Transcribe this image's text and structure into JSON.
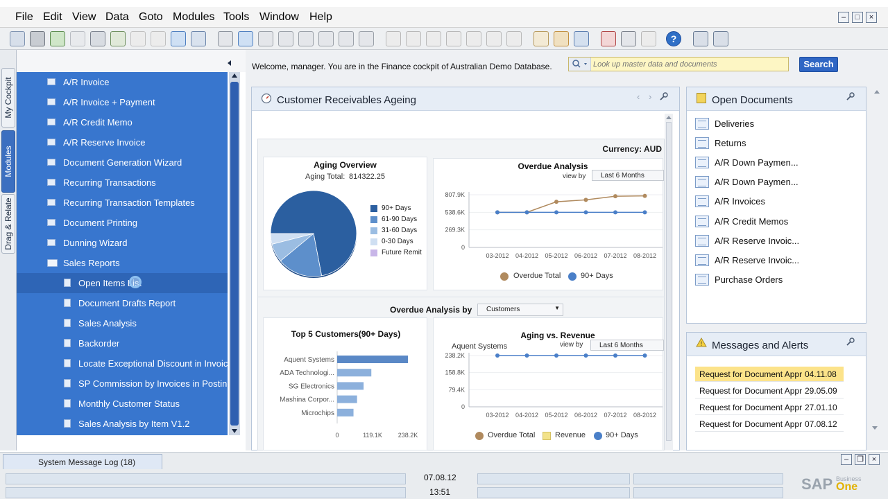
{
  "menu": [
    "File",
    "Edit",
    "View",
    "Data",
    "Goto",
    "Modules",
    "Tools",
    "Window",
    "Help"
  ],
  "vertical_tabs": [
    "My Cockpit",
    "Modules",
    "Drag & Relate"
  ],
  "modules": [
    {
      "label": "A/R Invoice",
      "icon": "form-icon"
    },
    {
      "label": "A/R Invoice + Payment",
      "icon": "form-icon"
    },
    {
      "label": "A/R Credit Memo",
      "icon": "form-icon"
    },
    {
      "label": "A/R Reserve Invoice",
      "icon": "form-icon"
    },
    {
      "label": "Document Generation Wizard",
      "icon": "form-icon"
    },
    {
      "label": "Recurring Transactions",
      "icon": "form-icon"
    },
    {
      "label": "Recurring Transaction Templates",
      "icon": "form-icon"
    },
    {
      "label": "Document Printing",
      "icon": "form-icon"
    },
    {
      "label": "Dunning Wizard",
      "icon": "form-icon"
    },
    {
      "label": "Sales Reports",
      "icon": "folder-open-icon"
    },
    {
      "label": "Open Items List",
      "icon": "report-icon"
    },
    {
      "label": "Document Drafts Report",
      "icon": "report-icon"
    },
    {
      "label": "Sales Analysis",
      "icon": "report-icon"
    },
    {
      "label": "Backorder",
      "icon": "report-icon"
    },
    {
      "label": "Locate Exceptional Discount in Invoice",
      "icon": "query-icon"
    },
    {
      "label": "SP Commission by Invoices in Posting",
      "icon": "query-icon"
    },
    {
      "label": "Monthly Customer Status",
      "icon": "layout-icon"
    },
    {
      "label": "Sales Analysis by Item V1.2",
      "icon": "layout-icon"
    }
  ],
  "welcome": "Welcome, manager. You are in the Finance cockpit of Australian Demo Database.",
  "search": {
    "placeholder": "Look up master data and documents",
    "button": "Search"
  },
  "receivables": {
    "title": "Customer Receivables Ageing",
    "currency": "Currency: AUD",
    "overdue_by_label": "Overdue Analysis by",
    "overdue_by_value": "Customers"
  },
  "aging_overview": {
    "title": "Aging Overview",
    "total_label": "Aging Total:",
    "total_value": "814322.25",
    "legend": [
      {
        "name": "90+ Days",
        "color": "#2b5fa0"
      },
      {
        "name": "61-90 Days",
        "color": "#5d8fcb"
      },
      {
        "name": "31-60 Days",
        "color": "#9bbde2"
      },
      {
        "name": "0-30 Days",
        "color": "#cfdff2"
      },
      {
        "name": "Future Remit",
        "color": "#c8b6e8"
      }
    ]
  },
  "overdue_analysis": {
    "title": "Overdue Analysis",
    "view_by": "view by",
    "period": "Last 6 Months",
    "legend": [
      "Overdue Total",
      "90+ Days"
    ]
  },
  "top5": {
    "title": "Top 5 Customers(90+ Days)"
  },
  "aging_revenue": {
    "title": "Aging vs. Revenue",
    "customer": "Aquent Systems",
    "view_by": "view by",
    "period": "Last 6 Months",
    "legend": [
      "Overdue Total",
      "Revenue",
      "90+ Days"
    ]
  },
  "chart_data": [
    {
      "type": "pie",
      "title": "Aging Overview",
      "labels": [
        "90+ Days",
        "61-90 Days",
        "31-60 Days",
        "0-30 Days",
        "Future Remit"
      ],
      "values": [
        72,
        17,
        7,
        4,
        0
      ]
    },
    {
      "type": "line",
      "title": "Overdue Analysis",
      "categories": [
        "03-2012",
        "04-2012",
        "05-2012",
        "06-2012",
        "07-2012",
        "08-2012"
      ],
      "yticks": [
        "0",
        "269.3K",
        "538.6K",
        "807.9K"
      ],
      "ylim": [
        0,
        807.9
      ],
      "series": [
        {
          "name": "Overdue Total",
          "color": "#b08a5e",
          "values": [
            538.6,
            538.6,
            700,
            730,
            785,
            790
          ]
        },
        {
          "name": "90+ Days",
          "color": "#4a7fc8",
          "values": [
            538.6,
            538.6,
            538.6,
            538.6,
            538.6,
            538.6
          ]
        }
      ]
    },
    {
      "type": "bar",
      "title": "Top 5 Customers(90+ Days)",
      "categories": [
        "Aquent Systems",
        "ADA Technologi...",
        "SG Electronics",
        "Mashina Corpor...",
        "Microchips"
      ],
      "values": [
        238.2,
        115,
        89,
        67,
        55
      ],
      "xticks": [
        "0",
        "119.1K",
        "238.2K"
      ],
      "xlim": [
        0,
        238.2
      ]
    },
    {
      "type": "line",
      "title": "Aging vs. Revenue",
      "categories": [
        "03-2012",
        "04-2012",
        "05-2012",
        "06-2012",
        "07-2012",
        "08-2012"
      ],
      "yticks": [
        "0",
        "79.4K",
        "158.8K",
        "238.2K"
      ],
      "ylim": [
        0,
        238.2
      ],
      "series": [
        {
          "name": "Overdue Total",
          "color": "#b08a5e",
          "values": [
            238.2,
            238.2,
            238.2,
            238.2,
            238.2,
            238.2
          ]
        },
        {
          "name": "Revenue",
          "color": "#f2e28a",
          "values": [
            238.2,
            238.2,
            238.2,
            238.2,
            238.2,
            238.2
          ]
        },
        {
          "name": "90+ Days",
          "color": "#4a7fc8",
          "values": [
            238.2,
            238.2,
            238.2,
            238.2,
            238.2,
            238.2
          ]
        }
      ]
    }
  ],
  "open_documents": {
    "title": "Open Documents",
    "items": [
      "Deliveries",
      "Returns",
      "A/R Down Paymen...",
      "A/R Down Paymen...",
      "A/R Invoices",
      "A/R Credit Memos",
      "A/R Reserve Invoic...",
      "A/R Reserve Invoic...",
      "Purchase Orders"
    ]
  },
  "messages": {
    "title": "Messages and Alerts",
    "items": [
      {
        "text": "Request for Document Approval",
        "date": "04.11.08"
      },
      {
        "text": "Request for Document Approval",
        "date": "29.05.09"
      },
      {
        "text": "Request for Document Approval",
        "date": "27.01.10"
      },
      {
        "text": "Request for Document Approval",
        "date": "07.08.12"
      }
    ]
  },
  "status": {
    "system_log": "System Message Log (18)",
    "date": "07.08.12",
    "time": "13:51"
  },
  "logo": {
    "brand": "SAP",
    "business": "Business",
    "one": "One"
  }
}
